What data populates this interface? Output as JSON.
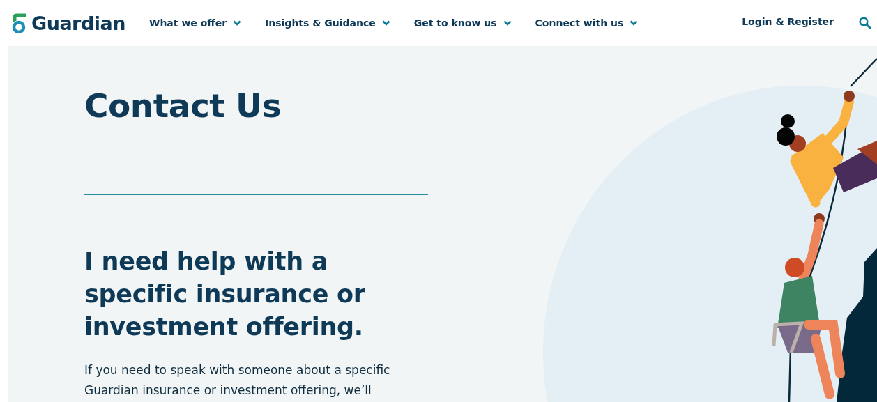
{
  "header": {
    "logo": "Guardian",
    "nav": [
      {
        "label": "What we offer",
        "expanded": false
      },
      {
        "label": "Insights & Guidance",
        "expanded": false
      },
      {
        "label": "Get to know us",
        "expanded": false
      },
      {
        "label": "Connect with us",
        "expanded": false
      }
    ],
    "login": "Login & Register"
  },
  "hero": {
    "title": "Contact Us",
    "subtitle": "I need help with a specific insurance or investment offering.",
    "body": "If you need to speak with someone about a specific Guardian insurance or investment offering, we’ll"
  }
}
